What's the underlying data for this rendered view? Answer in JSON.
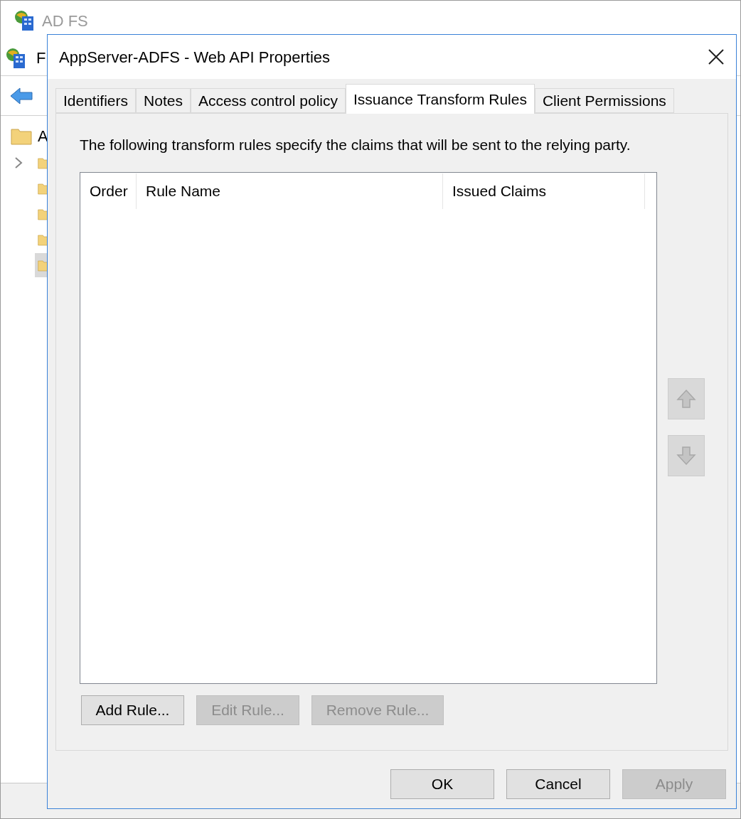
{
  "background_window": {
    "title": "AD FS",
    "menu_label": "F",
    "tree": {
      "root": "A",
      "children": [
        {
          "expandable": true,
          "selected": false
        },
        {
          "expandable": false,
          "selected": false
        },
        {
          "expandable": false,
          "selected": false
        },
        {
          "expandable": false,
          "selected": false
        },
        {
          "expandable": false,
          "selected": true
        }
      ]
    }
  },
  "dialog": {
    "title": "AppServer-ADFS - Web API Properties",
    "tabs": [
      {
        "label": "Identifiers",
        "selected": false
      },
      {
        "label": "Notes",
        "selected": false
      },
      {
        "label": "Access control policy",
        "selected": false
      },
      {
        "label": "Issuance Transform Rules",
        "selected": true
      },
      {
        "label": "Client Permissions",
        "selected": false
      }
    ],
    "description": "The following transform rules specify the claims that will be sent to the relying party.",
    "table": {
      "columns": [
        "Order",
        "Rule Name",
        "Issued Claims"
      ]
    },
    "move_buttons": [
      {
        "kind": "up",
        "disabled": true
      },
      {
        "kind": "down",
        "disabled": true
      }
    ],
    "rule_buttons": [
      {
        "label": "Add Rule...",
        "disabled": false
      },
      {
        "label": "Edit Rule...",
        "disabled": true
      },
      {
        "label": "Remove Rule...",
        "disabled": true
      }
    ],
    "buttons": [
      {
        "label": "OK",
        "disabled": false
      },
      {
        "label": "Cancel",
        "disabled": false
      },
      {
        "label": "Apply",
        "disabled": true
      }
    ]
  }
}
